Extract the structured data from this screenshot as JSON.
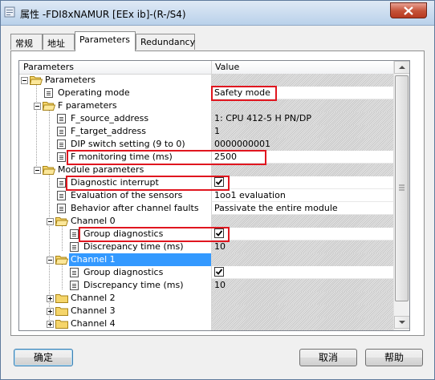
{
  "window": {
    "title": "属性 -FDI8xNAMUR [EEx ib]-(R-/S4)"
  },
  "tabs": [
    {
      "label": "常规"
    },
    {
      "label": "地址"
    },
    {
      "label": "Parameters"
    },
    {
      "label": "Redundancy"
    }
  ],
  "grid": {
    "col_parameters": "Parameters",
    "col_value": "Value",
    "rows": [
      {
        "label": "Parameters",
        "value": ""
      },
      {
        "label": "Operating mode",
        "value": "Safety mode"
      },
      {
        "label": "F parameters",
        "value": ""
      },
      {
        "label": "F_source_address",
        "value": "1: CPU 412-5 H PN/DP"
      },
      {
        "label": "F_target_address",
        "value": "1"
      },
      {
        "label": "DIP switch setting (9 to 0)",
        "value": "0000000001"
      },
      {
        "label": "F monitoring time (ms)",
        "value": "2500"
      },
      {
        "label": "Module parameters",
        "value": ""
      },
      {
        "label": "Diagnostic interrupt",
        "value": ""
      },
      {
        "label": "Evaluation of the sensors",
        "value": "1oo1 evaluation"
      },
      {
        "label": "Behavior after channel faults",
        "value": "Passivate the entire module"
      },
      {
        "label": "Channel 0",
        "value": ""
      },
      {
        "label": "Group diagnostics",
        "value": ""
      },
      {
        "label": "Discrepancy time (ms)",
        "value": "10"
      },
      {
        "label": "Channel 1",
        "value": ""
      },
      {
        "label": "Group diagnostics",
        "value": ""
      },
      {
        "label": "Discrepancy time (ms)",
        "value": "10"
      },
      {
        "label": "Channel 2",
        "value": ""
      },
      {
        "label": "Channel 3",
        "value": ""
      },
      {
        "label": "Channel 4",
        "value": ""
      }
    ]
  },
  "buttons": {
    "ok": "确定",
    "cancel": "取消",
    "help": "帮助"
  },
  "colors": {
    "highlight_box": "#e0161f",
    "selection": "#3399ff"
  }
}
